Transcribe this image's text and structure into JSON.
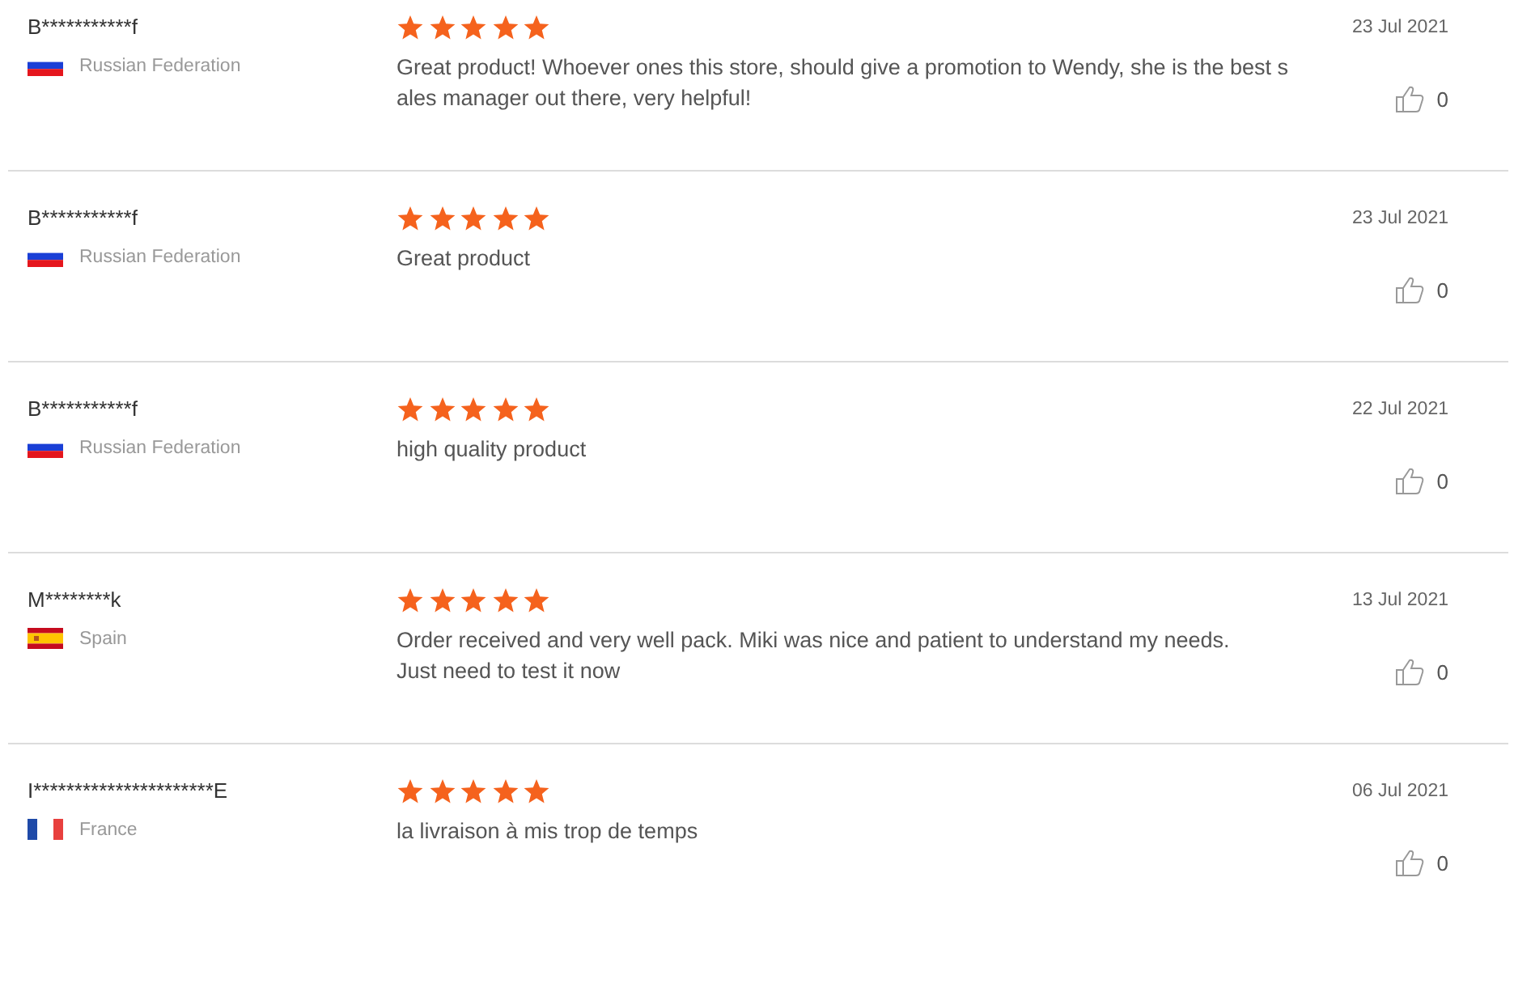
{
  "reviews": [
    {
      "author": "B***********f",
      "kind": "ru",
      "country": "Russian Federation",
      "stars": 5,
      "text": "Great product! Whoever ones this store, should give a promotion to Wendy, she is the best sales manager out there, very helpful!",
      "date": "23 Jul 2021",
      "likes": "0"
    },
    {
      "author": "B***********f",
      "kind": "ru",
      "country": "Russian Federation",
      "stars": 5,
      "text": "Great product",
      "date": "23 Jul 2021",
      "likes": "0"
    },
    {
      "author": "B***********f",
      "kind": "ru",
      "country": "Russian Federation",
      "stars": 5,
      "text": "high quality product",
      "date": "22 Jul 2021",
      "likes": "0"
    },
    {
      "author": "M********k",
      "kind": "es",
      "country": "Spain",
      "stars": 5,
      "text": "Order received and very well pack. Miki was nice and patient to understand my needs.\nJust need to test it now",
      "date": "13 Jul 2021",
      "likes": "0"
    },
    {
      "author": "I**********************E",
      "kind": "fr",
      "country": "France",
      "stars": 5,
      "text": "la livraison à mis trop de temps",
      "date": "06 Jul 2021",
      "likes": "0"
    }
  ]
}
